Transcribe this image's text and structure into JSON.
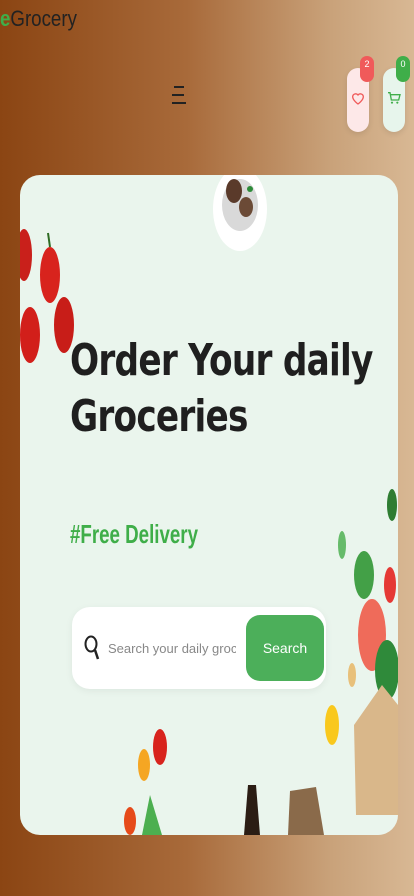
{
  "header": {
    "logo_prefix": "e",
    "logo_text": "Grocery",
    "wishlist_count": "2",
    "cart_count": "0"
  },
  "hero": {
    "title_line1": "Order Your daily",
    "title_line2": "Groceries",
    "tagline": "#Free Delivery"
  },
  "search": {
    "placeholder": "Search your daily groceries",
    "button_label": "Search"
  },
  "colors": {
    "accent": "#3fae49",
    "badge": "#f05a5a"
  }
}
